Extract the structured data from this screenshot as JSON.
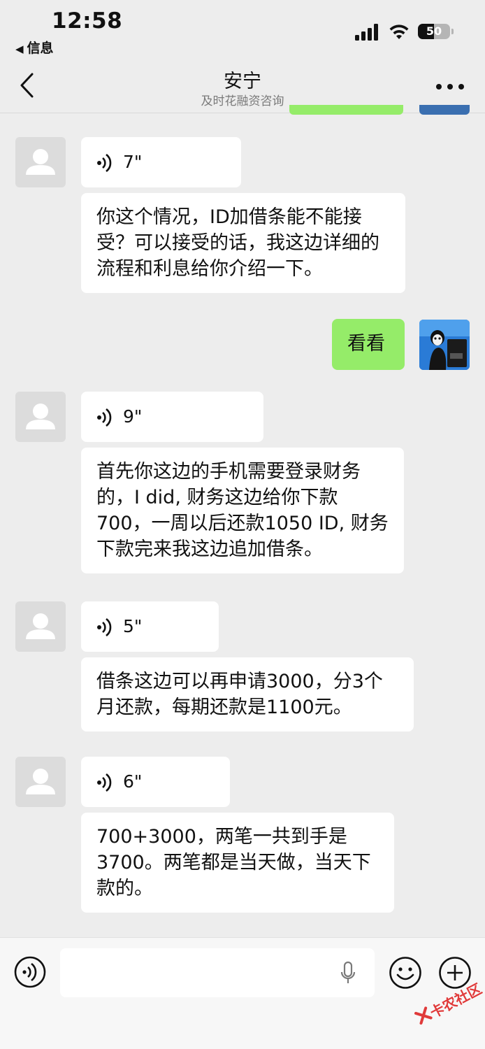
{
  "status_bar": {
    "time": "12:58",
    "back_app": "信息",
    "battery": "50"
  },
  "nav": {
    "title": "安宁",
    "subtitle": "及时花融资咨询"
  },
  "messages": [
    {
      "type": "voice",
      "side": "left",
      "duration": "7\""
    },
    {
      "type": "text",
      "side": "left",
      "text": "你这个情况，ID加借条能不能接受？可以接受的话，我这边详细的流程和利息给你介绍一下。"
    },
    {
      "type": "text",
      "side": "right",
      "text": "看看"
    },
    {
      "type": "voice",
      "side": "left",
      "duration": "9\""
    },
    {
      "type": "text",
      "side": "left",
      "text": "首先你这边的手机需要登录财务的，I did, 财务这边给你下款700，一周以后还款1050 ID, 财务下款完来我这边追加借条。"
    },
    {
      "type": "voice",
      "side": "left",
      "duration": "5\""
    },
    {
      "type": "text",
      "side": "left",
      "text": "借条这边可以再申请3000，分3个月还款，每期还款是1100元。"
    },
    {
      "type": "voice",
      "side": "left",
      "duration": "6\""
    },
    {
      "type": "text",
      "side": "left",
      "text": "700+3000，两笔一共到手是3700。两笔都是当天做，当天下款的。"
    }
  ],
  "input_bar": {
    "placeholder": ""
  },
  "watermark": {
    "text": "卡农社区"
  },
  "colors": {
    "background": "#ededed",
    "bubble_in": "#ffffff",
    "bubble_out": "#95ec69"
  }
}
